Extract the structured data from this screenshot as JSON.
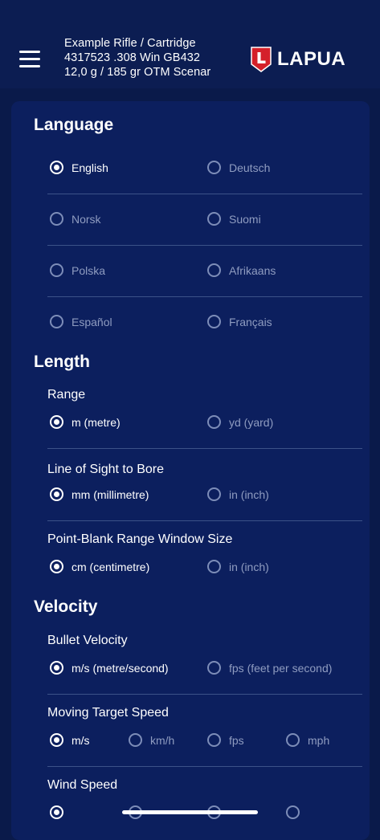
{
  "header": {
    "rifle_line": "Example Rifle / Cartridge",
    "cartridge_line": "4317523 .308 Win GB432",
    "bullet_line": "12,0 g / 185 gr  OTM Scenar",
    "logo_text": "LAPUA",
    "logo_letter": "L"
  },
  "language": {
    "title": "Language",
    "options": [
      "English",
      "Deutsch",
      "Norsk",
      "Suomi",
      "Polska",
      "Afrikaans",
      "Español",
      "Français"
    ],
    "selected": "English"
  },
  "length": {
    "title": "Length",
    "range": {
      "label": "Range",
      "options": [
        "m (metre)",
        "yd (yard)"
      ],
      "selected": "m (metre)"
    },
    "line_of_sight": {
      "label": "Line of Sight to Bore",
      "options": [
        "mm (millimetre)",
        "in (inch)"
      ],
      "selected": "mm (millimetre)"
    },
    "pbr_window": {
      "label": "Point-Blank Range Window Size",
      "options": [
        "cm (centimetre)",
        "in (inch)"
      ],
      "selected": "cm (centimetre)"
    }
  },
  "velocity": {
    "title": "Velocity",
    "bullet_velocity": {
      "label": "Bullet Velocity",
      "options": [
        "m/s (metre/second)",
        "fps (feet per  second)"
      ],
      "selected": "m/s (metre/second)"
    },
    "moving_target": {
      "label": "Moving Target Speed",
      "options": [
        "m/s",
        "km/h",
        "fps",
        "mph"
      ],
      "selected": "m/s"
    },
    "wind_speed": {
      "label": "Wind Speed"
    }
  },
  "colors": {
    "background": "#0a1a4a",
    "panel": "#0c1f5e",
    "accent_red": "#d4202a"
  }
}
